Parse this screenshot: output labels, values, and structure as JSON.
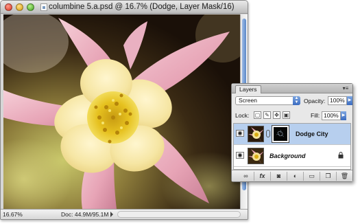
{
  "document": {
    "title": "columbine 5.a.psd @ 16.7% (Dodge, Layer Mask/16)",
    "zoom": "16.67%",
    "doc_size": "Doc: 44.9M/95.1M"
  },
  "layers_panel": {
    "tab_label": "Layers",
    "blend_mode": "Screen",
    "opacity_label": "Opacity:",
    "opacity_value": "100%",
    "lock_label": "Lock:",
    "fill_label": "Fill:",
    "fill_value": "100%",
    "layers": [
      {
        "name": "Dodge City",
        "selected": true,
        "has_mask": true
      },
      {
        "name": "Background",
        "selected": false,
        "locked": true
      }
    ],
    "footer_buttons": [
      "link-icon",
      "fx-icon",
      "mask-icon",
      "adjustment-icon",
      "folder-icon",
      "new-layer-icon",
      "trash-icon"
    ]
  },
  "colors": {
    "selection": "#b7cfee",
    "scroll_thumb": "#5c89c8"
  }
}
